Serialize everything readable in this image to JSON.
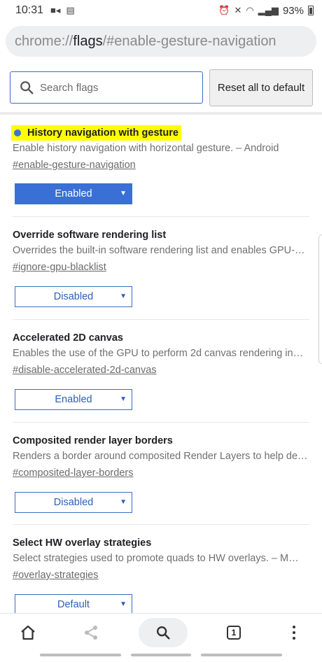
{
  "status_bar": {
    "time": "10:31",
    "battery_percent": "93%"
  },
  "url_bar": {
    "scheme": "chrome://",
    "host": "flags",
    "path": "/#enable-gesture-navigation"
  },
  "search": {
    "placeholder": "Search flags",
    "value": ""
  },
  "reset_button": {
    "label": "Reset all to default"
  },
  "flags": [
    {
      "title": "History navigation with gesture",
      "description": "Enable history navigation with horizontal gesture. – Android",
      "link": "#enable-gesture-navigation",
      "state": "Enabled",
      "highlighted": true
    },
    {
      "title": "Override software rendering list",
      "description": "Overrides the built-in software rendering list and enables GPU-…",
      "link": "#ignore-gpu-blacklist",
      "state": "Disabled",
      "highlighted": false
    },
    {
      "title": "Accelerated 2D canvas",
      "description": "Enables the use of the GPU to perform 2d canvas rendering in…",
      "link": "#disable-accelerated-2d-canvas",
      "state": "Enabled",
      "highlighted": false
    },
    {
      "title": "Composited render layer borders",
      "description": "Renders a border around composited Render Layers to help de…",
      "link": "#composited-layer-borders",
      "state": "Disabled",
      "highlighted": false
    },
    {
      "title": "Select HW overlay strategies",
      "description": "Select strategies used to promote quads to HW overlays. – M…",
      "link": "#overlay-strategies",
      "state": "Default",
      "highlighted": false
    }
  ],
  "bottom_bar": {
    "tab_count": "1",
    "icons": [
      "home-icon",
      "share-icon",
      "search-icon",
      "tab-switcher-icon",
      "more-vert-icon"
    ]
  },
  "colors": {
    "highlight": "#ffff00",
    "accent_blue": "#3a6fd6",
    "select_border": "#3a6fc0"
  }
}
